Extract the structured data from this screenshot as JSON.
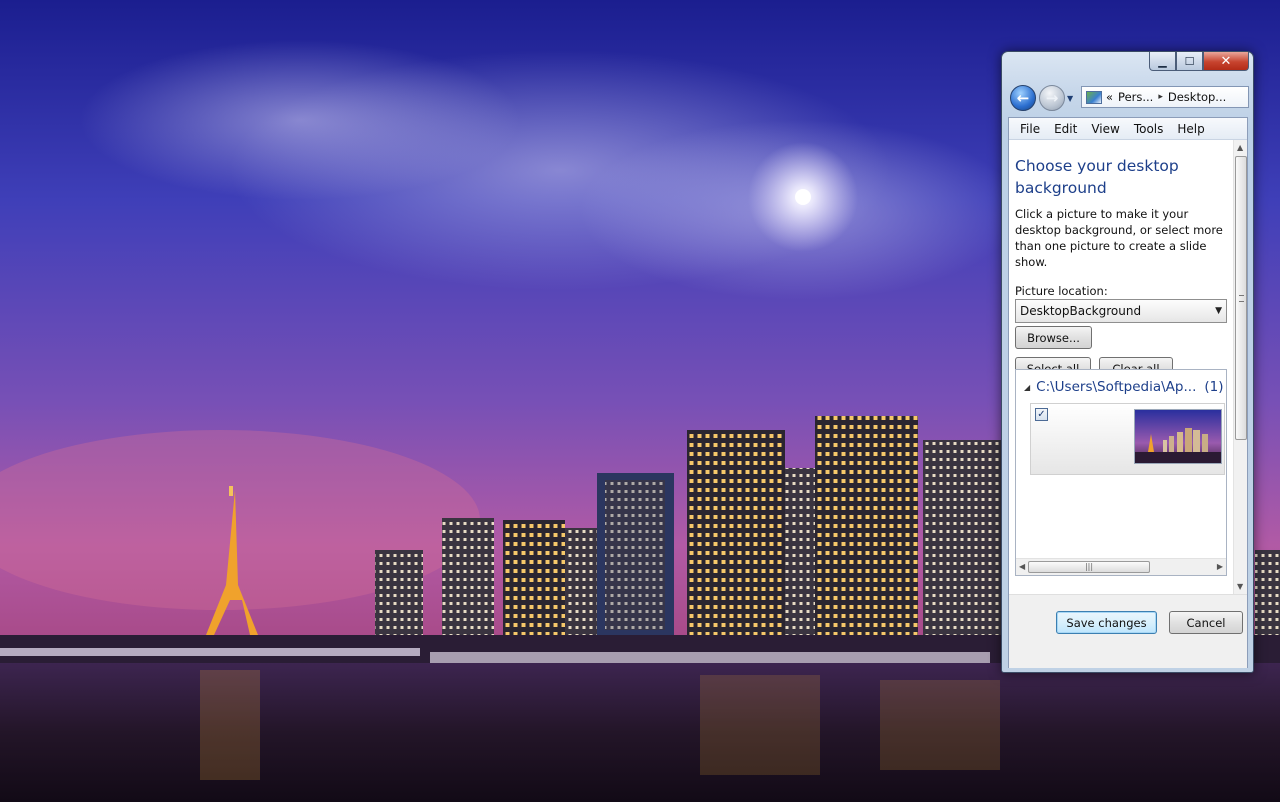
{
  "window": {
    "title_controls": {
      "minimize": "▁",
      "maximize": "☐",
      "close": "✕"
    },
    "address": {
      "chevrons": "«",
      "crumb1": "Pers...",
      "sep": "▸",
      "crumb2": "Desktop..."
    }
  },
  "menu": [
    "File",
    "Edit",
    "View",
    "Tools",
    "Help"
  ],
  "page": {
    "heading": "Choose your desktop background",
    "description": "Click a picture to make it your desktop background, or select more than one picture to create a slide show.",
    "location_label": "Picture location:",
    "location_value": "DesktopBackground",
    "browse_label": "Browse...",
    "select_all_label": "Select all",
    "clear_all_label": "Clear all"
  },
  "gallery": {
    "group_title": "C:\\Users\\Softpedia\\Ap...",
    "group_count": "(1)",
    "checkbox_mark": "✓"
  },
  "footer": {
    "save_label": "Save changes",
    "cancel_label": "Cancel"
  },
  "colors": {
    "accent": "#1d3f8a",
    "window_frame": "#bcd0e6",
    "close_red": "#c7442f"
  },
  "icons": {
    "back": "back-arrow-icon",
    "forward": "forward-arrow-icon",
    "address": "personalization-icon"
  }
}
